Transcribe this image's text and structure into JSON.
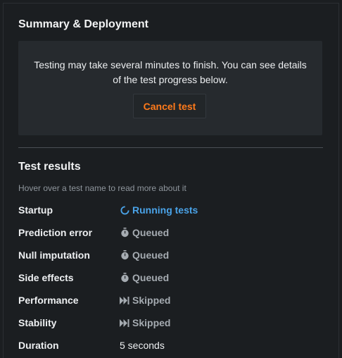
{
  "summary": {
    "title": "Summary & Deployment",
    "notice_line1": "Testing may take several minutes to finish. You can see details",
    "notice_line2": "of the test progress below.",
    "cancel_label": "Cancel test"
  },
  "results": {
    "title": "Test results",
    "hint": "Hover over a test name to read more about it",
    "rows": [
      {
        "label": "Startup",
        "status": "Running tests",
        "icon": "spinner-icon"
      },
      {
        "label": "Prediction error",
        "status": "Queued",
        "icon": "stopwatch-icon"
      },
      {
        "label": "Null imputation",
        "status": "Queued",
        "icon": "stopwatch-icon"
      },
      {
        "label": "Side effects",
        "status": "Queued",
        "icon": "stopwatch-icon"
      },
      {
        "label": "Performance",
        "status": "Skipped",
        "icon": "skip-forward-icon"
      },
      {
        "label": "Stability",
        "status": "Skipped",
        "icon": "skip-forward-icon"
      },
      {
        "label": "Duration",
        "status": "5 seconds",
        "icon": ""
      }
    ]
  },
  "colors": {
    "accent_orange": "#ff7a1a",
    "running_blue": "#4aa3e8",
    "muted_gray": "#a5abb1"
  }
}
